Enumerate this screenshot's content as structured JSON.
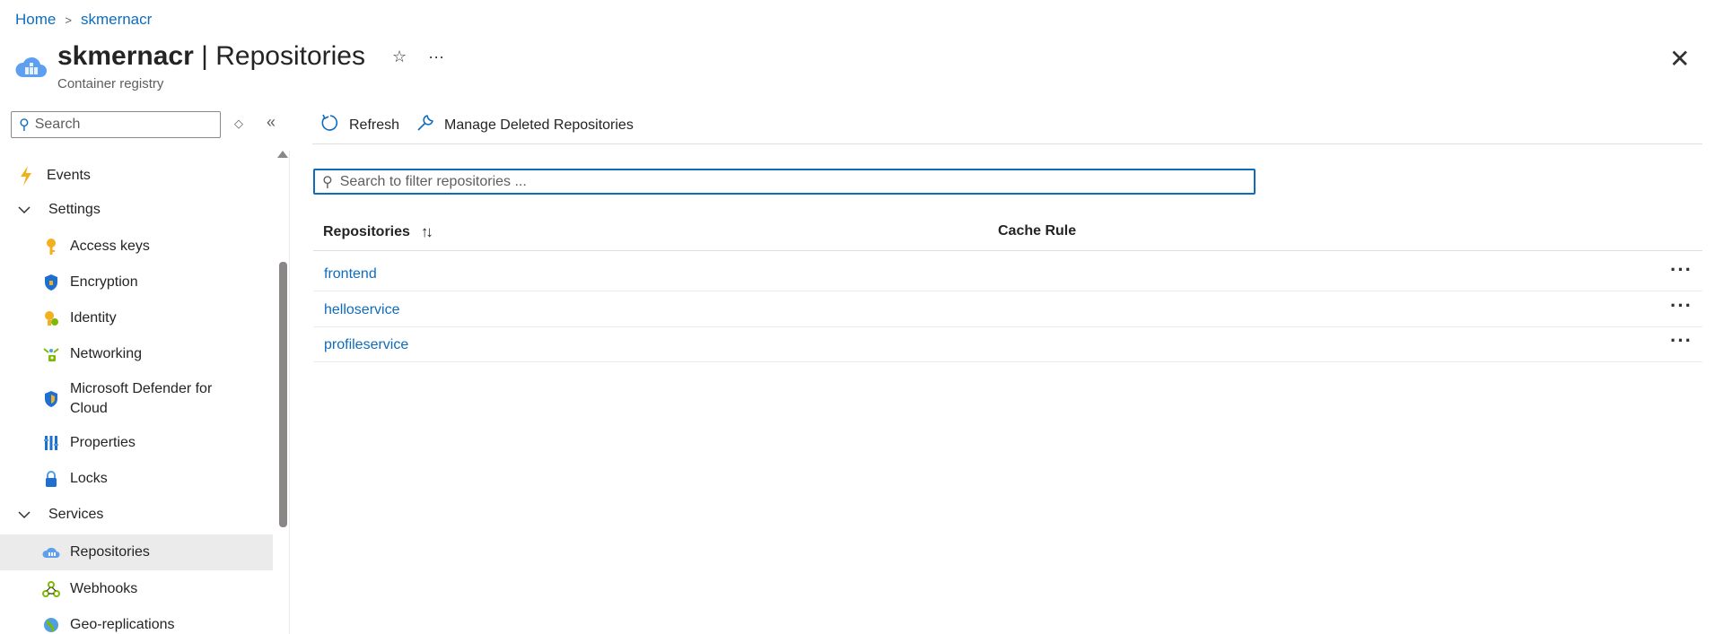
{
  "breadcrumb": {
    "home": "Home",
    "resource": "skmernacr"
  },
  "header": {
    "resource_name": "skmernacr",
    "separator": " | ",
    "page_name": "Repositories",
    "subtitle": "Container registry",
    "favorite_icon": "star-icon",
    "more_icon": "ellipsis-icon",
    "close_icon": "close-icon"
  },
  "nav": {
    "search_placeholder": "Search",
    "items": [
      {
        "label": "Events",
        "type": "top",
        "icon": "lightning-icon"
      },
      {
        "label": "Settings",
        "type": "group",
        "icon": "chevron-down-icon"
      },
      {
        "label": "Access keys",
        "type": "sub",
        "icon": "key-icon"
      },
      {
        "label": "Encryption",
        "type": "sub",
        "icon": "shield-icon"
      },
      {
        "label": "Identity",
        "type": "sub",
        "icon": "identity-icon"
      },
      {
        "label": "Networking",
        "type": "sub",
        "icon": "networking-icon"
      },
      {
        "label": "Microsoft Defender for",
        "label2": "Cloud",
        "type": "sub",
        "icon": "defender-icon"
      },
      {
        "label": "Properties",
        "type": "sub",
        "icon": "properties-icon"
      },
      {
        "label": "Locks",
        "type": "sub",
        "icon": "lock-icon"
      },
      {
        "label": "Services",
        "type": "group",
        "icon": "chevron-down-icon"
      },
      {
        "label": "Repositories",
        "type": "sub",
        "icon": "cloud-icon",
        "active": true
      },
      {
        "label": "Webhooks",
        "type": "sub",
        "icon": "webhook-icon"
      },
      {
        "label": "Geo-replications",
        "type": "sub",
        "icon": "globe-icon"
      }
    ]
  },
  "toolbar": {
    "refresh_label": "Refresh",
    "manage_deleted_label": "Manage Deleted Repositories"
  },
  "filter": {
    "placeholder": "Search to filter repositories ..."
  },
  "table": {
    "columns": [
      "Repositories",
      "Cache Rule"
    ],
    "rows": [
      {
        "name": "frontend",
        "cache_rule": ""
      },
      {
        "name": "helloservice",
        "cache_rule": ""
      },
      {
        "name": "profileservice",
        "cache_rule": ""
      }
    ]
  },
  "colors": {
    "accent": "#0f6cbd",
    "active_bg": "#ebebeb",
    "border": "#e1dfdd"
  }
}
